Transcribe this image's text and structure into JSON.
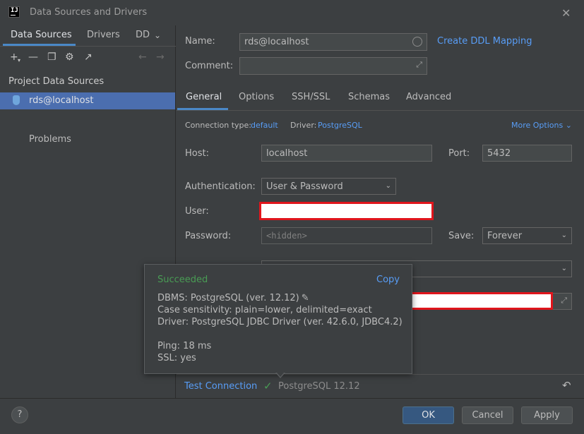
{
  "window": {
    "title": "Data Sources and Drivers",
    "app_logo": "IJ"
  },
  "left": {
    "tabs": [
      "Data Sources",
      "Drivers",
      "DD"
    ],
    "section_title": "Project Data Sources",
    "data_source": "rds@localhost",
    "problems": "Problems"
  },
  "form": {
    "name_label": "Name:",
    "name_value": "rds@localhost",
    "create_ddl": "Create DDL Mapping",
    "comment_label": "Comment:",
    "tabs": [
      "General",
      "Options",
      "SSH/SSL",
      "Schemas",
      "Advanced"
    ],
    "conn_type_label": "Connection type:",
    "conn_type_value": "default",
    "driver_label": "Driver:",
    "driver_value": "PostgreSQL",
    "more_options": "More Options",
    "host_label": "Host:",
    "host_value": "localhost",
    "port_label": "Port:",
    "port_value": "5432",
    "auth_label": "Authentication:",
    "auth_value": "User & Password",
    "user_label": "User:",
    "password_label": "Password:",
    "password_placeholder": "<hidden>",
    "save_label": "Save:",
    "save_value": "Forever"
  },
  "popup": {
    "status": "Succeeded",
    "copy": "Copy",
    "dbms": "DBMS: PostgreSQL (ver. 12.12)",
    "case": "Case sensitivity: plain=lower, delimited=exact",
    "driver": "Driver: PostgreSQL JDBC Driver (ver. 42.6.0, JDBC4.2)",
    "ping": "Ping: 18 ms",
    "ssl": "SSL: yes"
  },
  "bottom": {
    "test_connection": "Test Connection",
    "result": "PostgreSQL 12.12"
  },
  "footer": {
    "help": "?",
    "ok": "OK",
    "cancel": "Cancel",
    "apply": "Apply"
  },
  "colors": {
    "accent": "#589df6",
    "success": "#499c54",
    "highlight": "#e0151c"
  }
}
